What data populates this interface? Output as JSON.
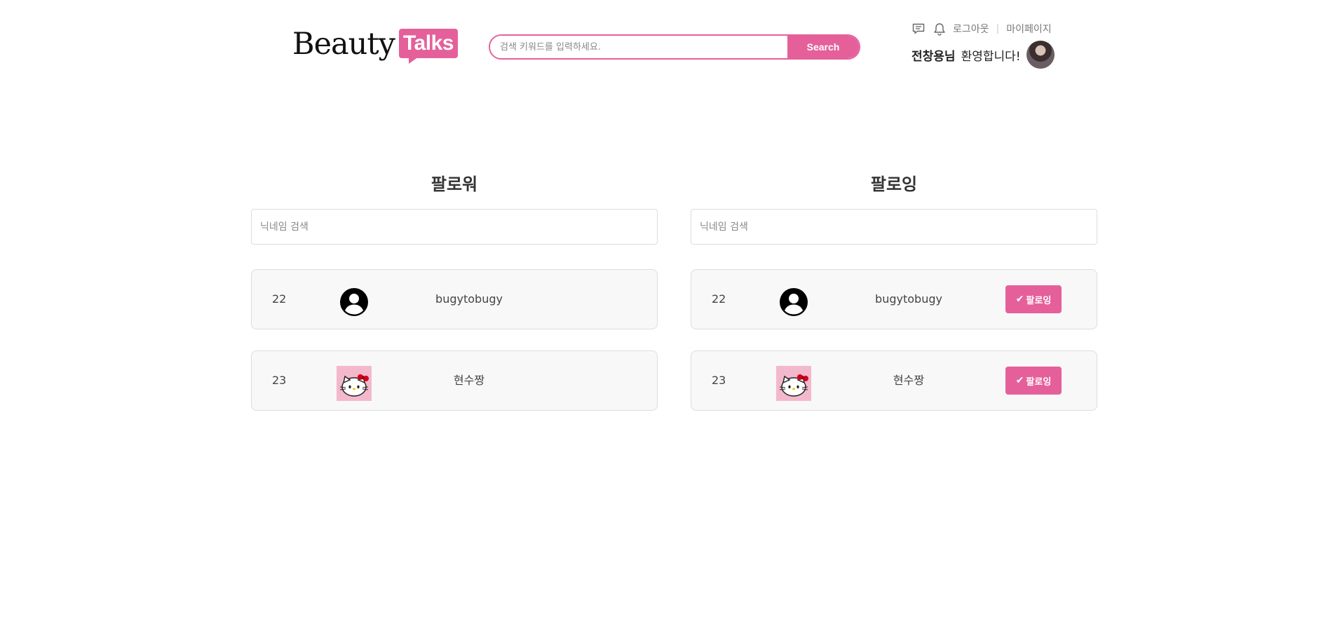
{
  "header": {
    "logo_part1": "Beauty",
    "logo_part2": "Talks",
    "search_placeholder": "검색 키워드를 입력하세요.",
    "search_button": "Search",
    "logout_label": "로그아웃",
    "separator": "|",
    "mypage_label": "마이페이지",
    "user_name": "전창용님",
    "welcome_text": "환영합니다!",
    "icons": [
      "chat-icon",
      "bell-icon"
    ]
  },
  "followers": {
    "title": "팔로워",
    "search_placeholder": "닉네임 검색",
    "items": [
      {
        "num": "22",
        "nickname": "bugytobugy",
        "avatar": "default-user-icon"
      },
      {
        "num": "23",
        "nickname": "현수짱",
        "avatar": "hello-kitty-image"
      }
    ]
  },
  "following": {
    "title": "팔로잉",
    "search_placeholder": "닉네임 검색",
    "button_check": "✔",
    "button_label": "팔로잉",
    "items": [
      {
        "num": "22",
        "nickname": "bugytobugy",
        "avatar": "default-user-icon"
      },
      {
        "num": "23",
        "nickname": "현수짱",
        "avatar": "hello-kitty-image"
      }
    ]
  },
  "colors": {
    "accent": "#e5609a",
    "row_bg": "#f8f8f8",
    "border": "#dddddd"
  }
}
